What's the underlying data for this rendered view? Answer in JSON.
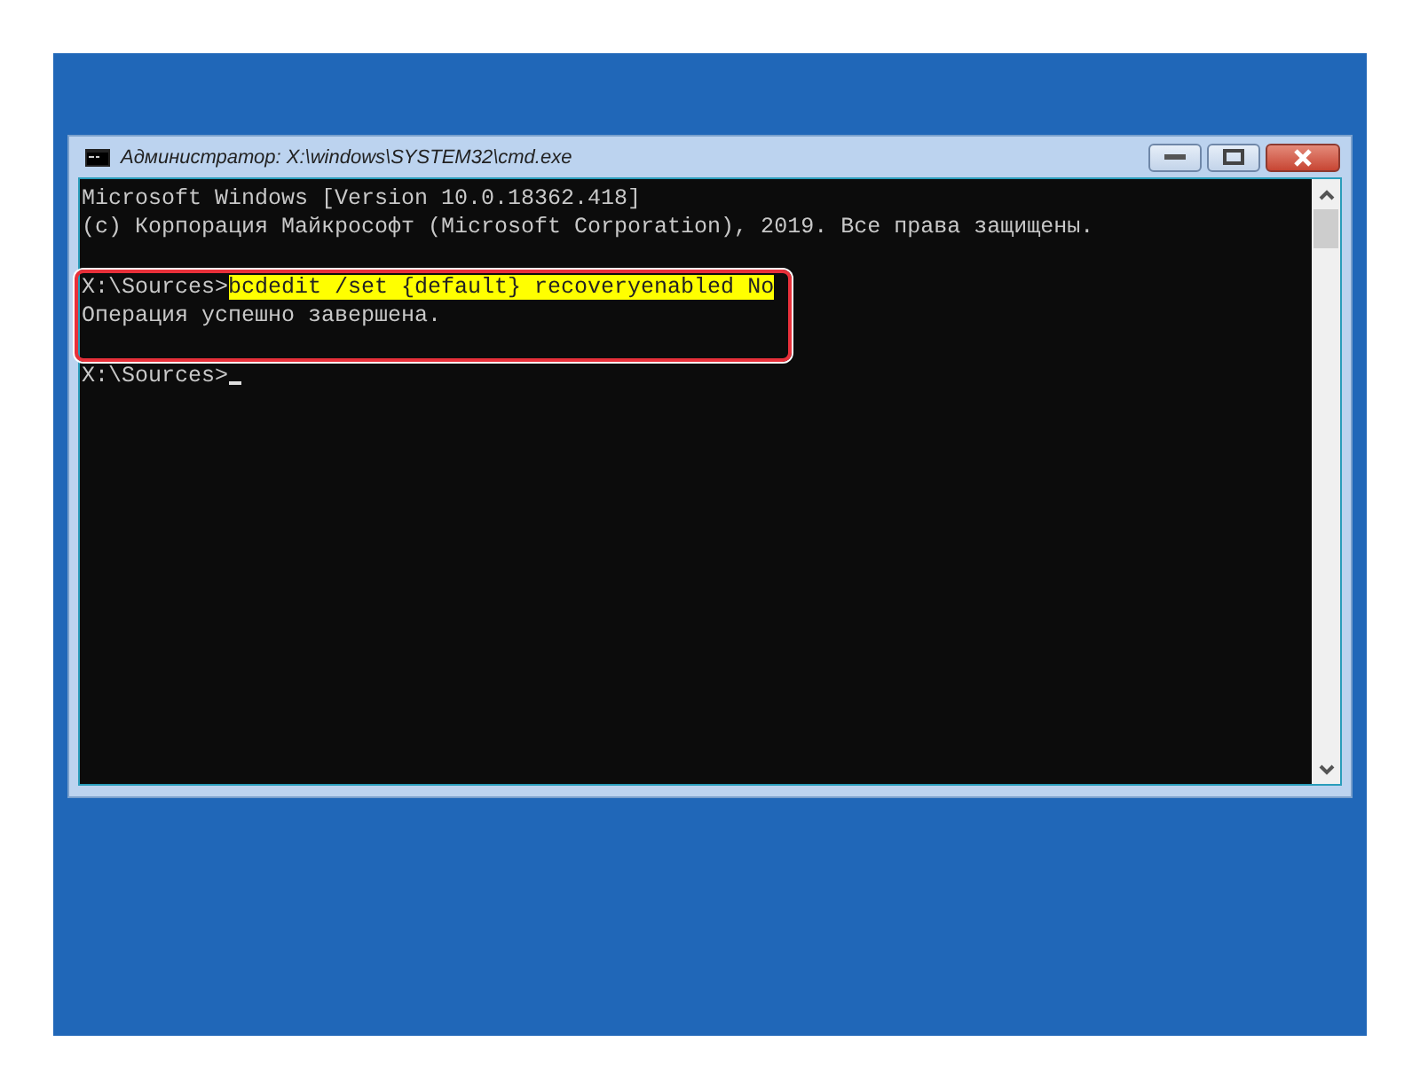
{
  "window": {
    "title": "Администратор: X:\\windows\\SYSTEM32\\cmd.exe"
  },
  "console": {
    "lines": [
      {
        "kind": "output",
        "text": "Microsoft Windows [Version 10.0.18362.418]"
      },
      {
        "kind": "output",
        "text": "(c) Корпорация Майкрософт (Microsoft Corporation), 2019. Все права защищены."
      },
      {
        "kind": "blank"
      },
      {
        "kind": "command",
        "prompt": "X:\\Sources>",
        "command": "bcdedit /set {default} recoveryenabled No",
        "highlighted": true,
        "framed": true
      },
      {
        "kind": "output",
        "text": "Операция успешно завершена.",
        "framed": true
      },
      {
        "kind": "blank",
        "framed": true
      },
      {
        "kind": "command",
        "prompt": "X:\\Sources>",
        "cursor": true
      }
    ]
  }
}
